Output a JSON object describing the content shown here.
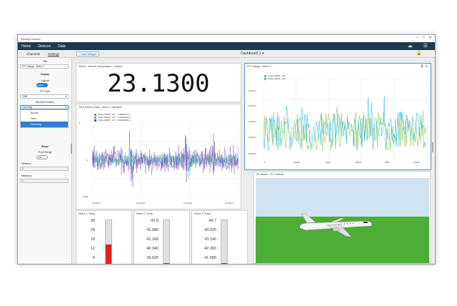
{
  "app": {
    "title": "SensorConnect",
    "window_controls": [
      "–",
      "□",
      "✕"
    ]
  },
  "menu": {
    "items": [
      "Home",
      "Devices",
      "Data"
    ],
    "right_icons": [
      "cloud-icon",
      "hamburger-menu-icon"
    ]
  },
  "toolbar": {
    "tabs": [
      "Channels",
      "Settings"
    ],
    "active_tab": "Settings",
    "add_widget_label": "+ Add Widget",
    "dashboard_label": "Dashboard 1",
    "dashboard_caret": "▾"
  },
  "sidebar": {
    "title_label": "Title",
    "title_value": "FFT Gauge - Motor 2",
    "display_label": "Display",
    "legend_label": "Legend",
    "legend_toggle": "Active",
    "fft_size_label": "FFT Size",
    "fft_size_value": "2048",
    "window_function_label": "Window Function",
    "window_function_value": "Hamming",
    "window_options": [
      "Boxcar",
      "Hann",
      "Hamming"
    ],
    "range_label": "Range",
    "fixed_range_label": "Fixed Range",
    "fixed_range_toggle": "Off",
    "minimum_label": "Minimum",
    "minimum_value": "0",
    "maximum_label": "Maximum",
    "maximum_value": "1"
  },
  "widgets": {
    "temperature": {
      "title": "40415 - Internal Temperature - Celsius",
      "value": "23.1300"
    },
    "time_series": {
      "title": "Time Series Graph - Motor 2 Vibration",
      "legend": [
        {
          "label": "fixode-40415 : ch1 : -1.88946e4 g",
          "color": "#4caf50"
        },
        {
          "label": "fixode-40415 : ch2 : -1.24974e4 g",
          "color": "#29b6d6"
        },
        {
          "label": "fixode-40415 : ch3 : 5.00030820 g",
          "color": "#7b3fb5"
        }
      ],
      "y_ticks": [
        "3",
        "0",
        "-3.000"
      ],
      "x_ticks": [
        "12:24:17",
        "12:24:48",
        "12:26:18",
        "12:26:47"
      ]
    },
    "fft": {
      "title": "FFT Gauge - Motor 2",
      "controls": [
        "⎘",
        "✕"
      ],
      "legend": [
        {
          "label": "fixode-40415 : ch1",
          "color": "#8bc34a"
        },
        {
          "label": "fixode-40415 : ch2",
          "color": "#29b6d6"
        }
      ],
      "y_ticks": [
        "2.250e-6",
        "2.000e-6",
        "1.750e-6",
        "1.500e-6",
        "2.000e-6"
      ],
      "x_ticks": [
        "0",
        "0.5kHz",
        "1kHz",
        "1.5kHz",
        "2kHz",
        "2.5kHz"
      ]
    },
    "model": {
      "title": "3D Model - CV7 Attitude"
    },
    "gauges": [
      {
        "title": "Motor 1 Temp",
        "ticks": [
          "30",
          "24",
          "18",
          "12",
          "6"
        ],
        "fill_fraction": 0.45
      },
      {
        "title": "Motor 2 Temp",
        "ticks": [
          "42.8",
          "41.980",
          "41.160",
          "40.340",
          "39.520"
        ],
        "fill_fraction": 0.03
      },
      {
        "title": "Motor 3 Temp",
        "ticks": [
          "44.7",
          "43.920",
          "43.140",
          "42.360",
          "41.580"
        ],
        "fill_fraction": 0.03
      }
    ]
  },
  "colors": {
    "menubar": "#1e3a4e",
    "accent": "#2f7fd1",
    "gauge_fill": "#e02020",
    "sky": "#cfe3f3",
    "grass": "#4cae37"
  }
}
